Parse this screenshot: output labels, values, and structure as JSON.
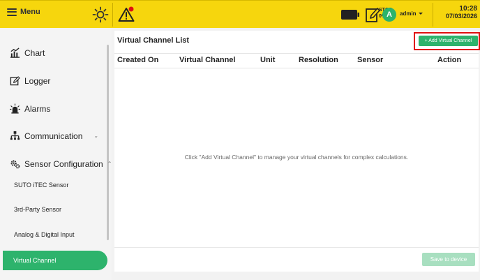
{
  "topbar": {
    "menu_label": "Menu",
    "stop_label": "STOP",
    "stop_percent": "0%",
    "user_initial": "A",
    "user_name": "admin",
    "time": "10:28",
    "date": "07/03/2026",
    "icons": [
      "hamburger-icon",
      "sun-icon",
      "alarm-warning-icon",
      "battery-icon",
      "stop-recording-icon"
    ]
  },
  "sidebar": {
    "items": [
      {
        "label": "Chart",
        "icon": "chart-icon"
      },
      {
        "label": "Logger",
        "icon": "logger-icon"
      },
      {
        "label": "Alarms",
        "icon": "alarms-icon"
      },
      {
        "label": "Communication",
        "icon": "network-icon"
      },
      {
        "label": "Sensor Configuration",
        "icon": "gear-icon"
      }
    ],
    "sub_items": [
      {
        "label": "SUTO iTEC Sensor"
      },
      {
        "label": "3rd-Party Sensor"
      },
      {
        "label": "Analog & Digital Input"
      },
      {
        "label": "Virtual Channel",
        "active": true
      }
    ]
  },
  "main": {
    "title": "Virtual Channel List",
    "add_button": "+ Add Virtual Channel",
    "columns": [
      "Created On",
      "Virtual Channel",
      "Unit",
      "Resolution",
      "Sensor",
      "Action"
    ],
    "empty_message": "Click \"Add Virtual Channel\" to manage your virtual channels for complex calculations.",
    "save_button": "Save to device"
  },
  "colors": {
    "topbar": "#f6d60d",
    "accent_green": "#2db36c",
    "highlight_red": "#e01010"
  }
}
